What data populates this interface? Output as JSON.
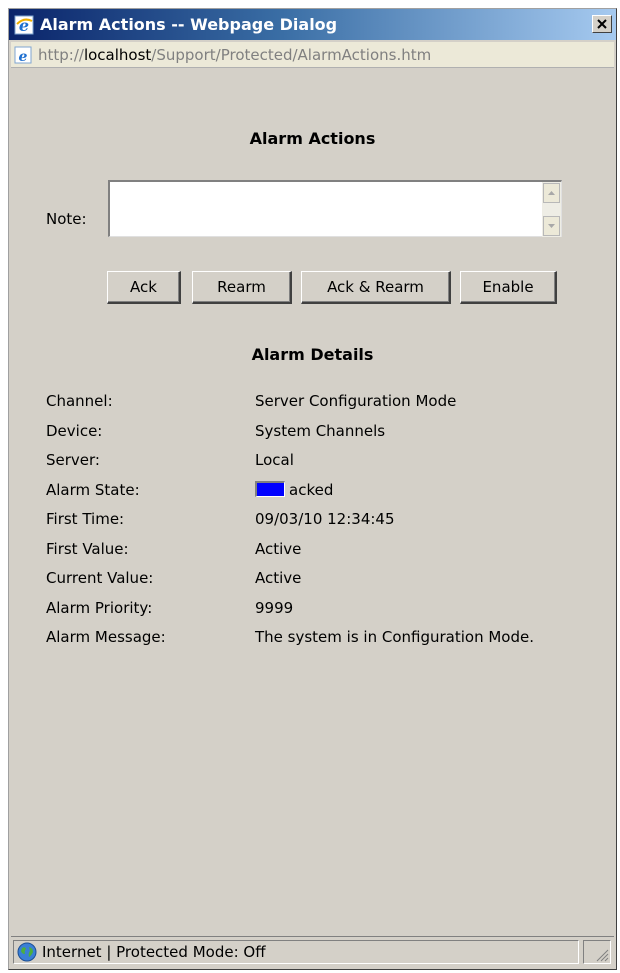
{
  "window": {
    "title": "Alarm Actions -- Webpage Dialog",
    "close_glyph": "✕"
  },
  "address_bar": {
    "scheme": "http://",
    "host": "localhost",
    "path": "/Support/Protected/AlarmActions.htm",
    "icon": "ie-page-icon"
  },
  "actions": {
    "heading": "Alarm Actions",
    "note_label": "Note:",
    "note_value": "",
    "buttons": {
      "ack": "Ack",
      "rearm": "Rearm",
      "ack_rearm": "Ack & Rearm",
      "enable": "Enable"
    }
  },
  "details": {
    "heading": "Alarm Details",
    "rows": [
      {
        "label": "Channel:",
        "value": "Server Configuration Mode"
      },
      {
        "label": "Device:",
        "value": "System Channels"
      },
      {
        "label": "Server:",
        "value": "Local"
      },
      {
        "label": "Alarm State:",
        "value": "acked",
        "swatch_color": "#0000ff"
      },
      {
        "label": "First Time:",
        "value": "09/03/10 12:34:45"
      },
      {
        "label": "First Value:",
        "value": "Active"
      },
      {
        "label": "Current Value:",
        "value": "Active"
      },
      {
        "label": "Alarm Priority:",
        "value": "9999"
      },
      {
        "label": "Alarm Message:",
        "value": "The system is in Configuration Mode."
      }
    ]
  },
  "status_bar": {
    "zone": "Internet | Protected Mode: Off",
    "icon": "globe-icon"
  },
  "colors": {
    "title_bar": "#0a246a",
    "dialog_bg": "#d4d0c8",
    "alarm_state_swatch": "#0000ff"
  }
}
